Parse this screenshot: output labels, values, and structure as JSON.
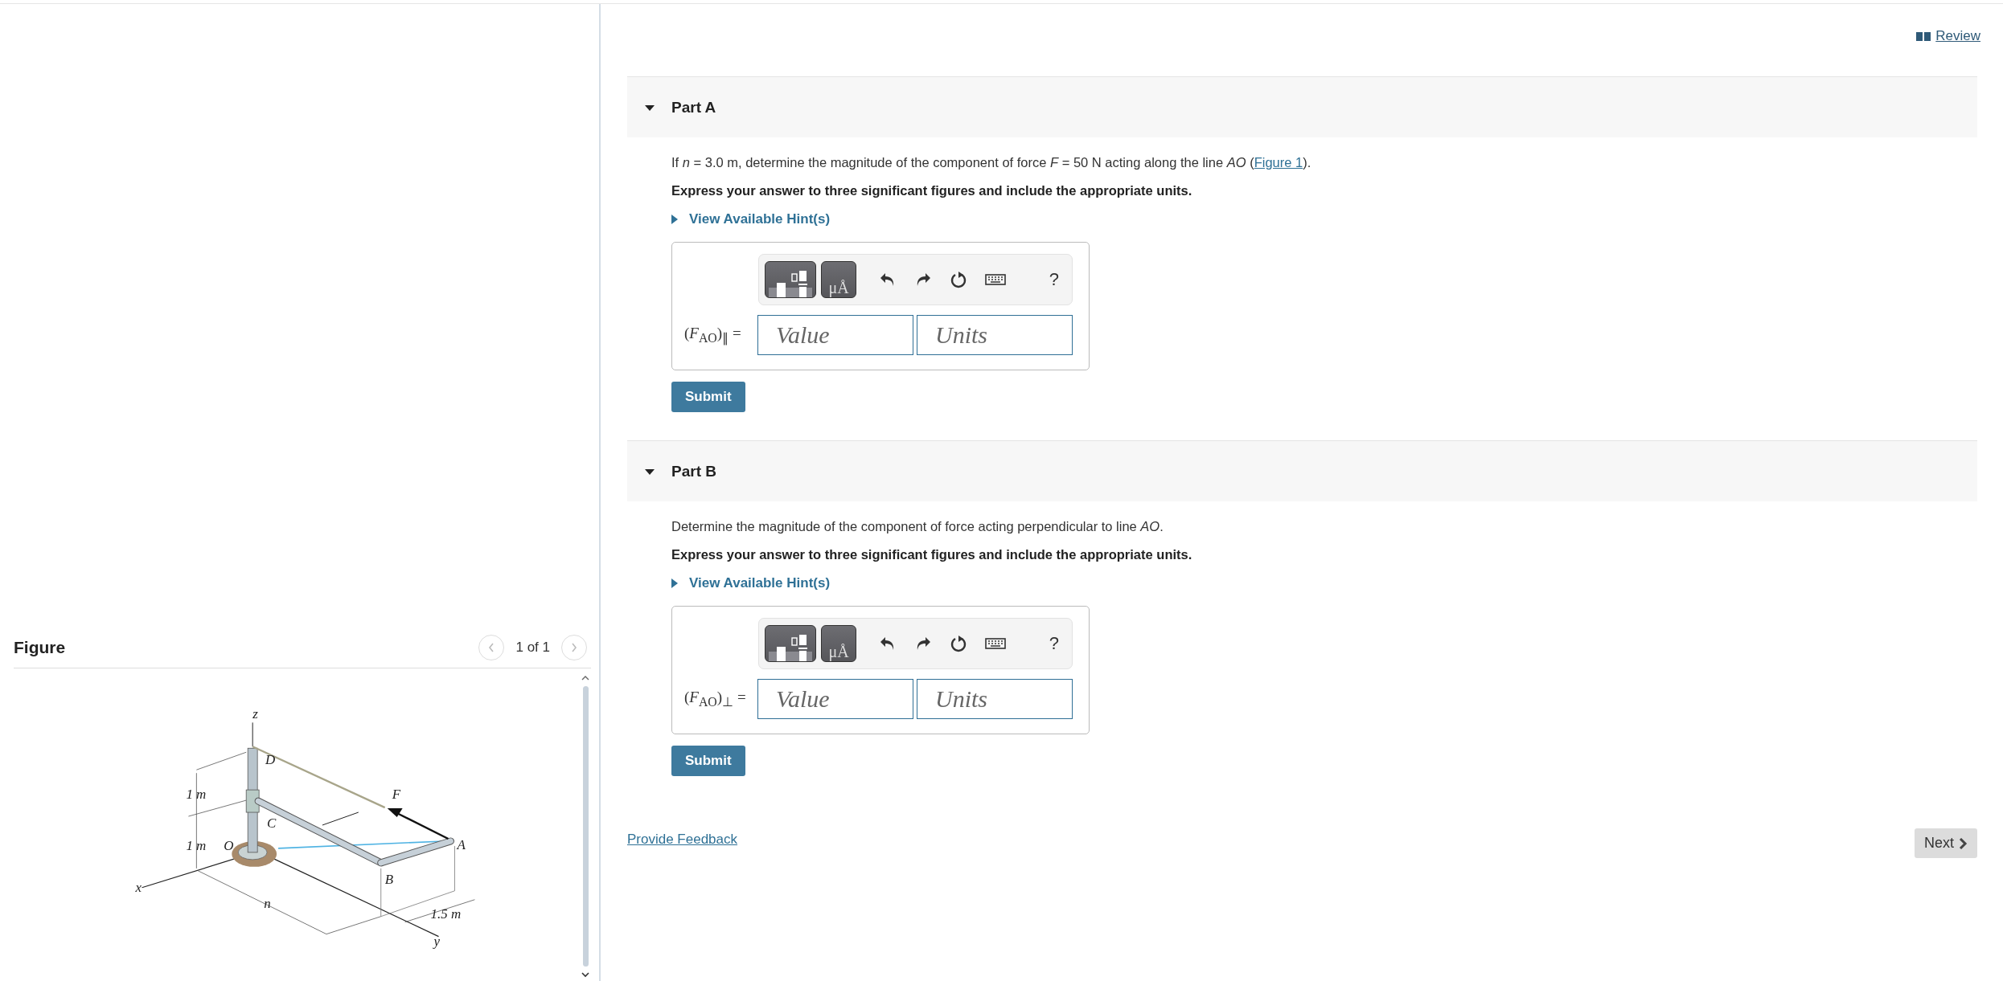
{
  "review_link": "Review",
  "figure": {
    "title": "Figure",
    "pager": "1 of 1",
    "labels": [
      "z",
      "D",
      "1 m",
      "F",
      "C",
      "1 m",
      "O",
      "A",
      "B",
      "x",
      "n",
      "1.5 m",
      "y"
    ]
  },
  "parts": [
    {
      "title": "Part A",
      "expanded": true,
      "question": {
        "text": "If *n* = 3.0 m, determine the magnitude of the component of force *F* = 50 N acting along the line *AO* (",
        "link": "Figure 1",
        "after": ")."
      },
      "instruction": "Express your answer to three significant figures and include the appropriate units.",
      "hint_toggle": "View Available Hint(s)",
      "toolbar": {
        "units_button": "μÅ",
        "help": "?"
      },
      "answer": {
        "label": "(*F*$_{AO}$)$_{∥}$ =",
        "value_placeholder": "Value",
        "units_placeholder": "Units"
      },
      "submit": "Submit"
    },
    {
      "title": "Part B",
      "expanded": true,
      "question": {
        "text": "Determine the magnitude of the component of force acting perpendicular to line *AO*."
      },
      "instruction": "Express your answer to three significant figures and include the appropriate units.",
      "hint_toggle": "View Available Hint(s)",
      "toolbar": {
        "units_button": "μÅ",
        "help": "?"
      },
      "answer": {
        "label": "(*F*$_{AO}$)$_{⊥}$ =",
        "value_placeholder": "Value",
        "units_placeholder": "Units"
      },
      "submit": "Submit"
    }
  ],
  "feedback_link": "Provide Feedback",
  "next_button": "Next"
}
